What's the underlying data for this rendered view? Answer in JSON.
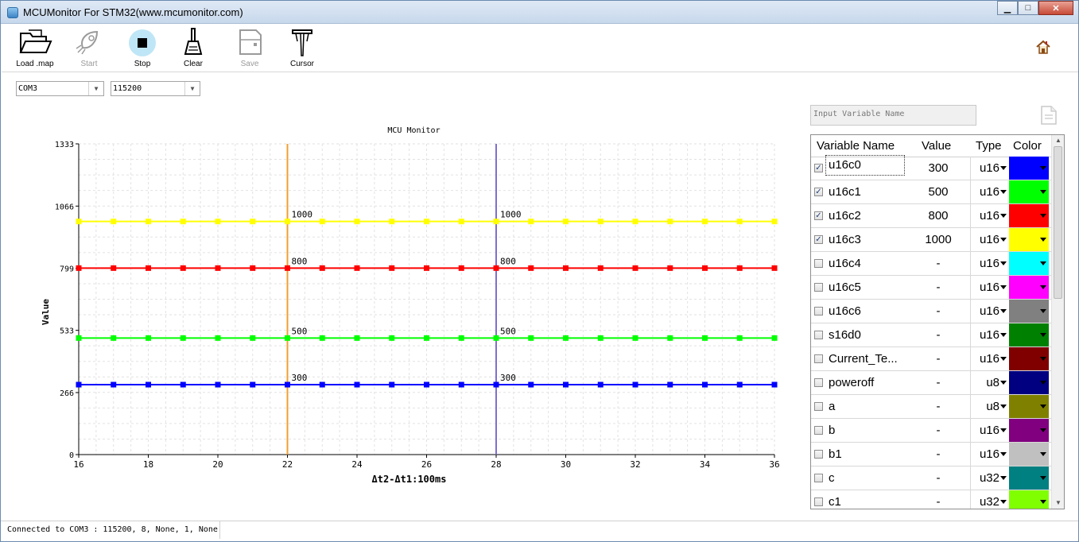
{
  "window": {
    "title": "MCUMonitor For STM32(www.mcumonitor.com)",
    "controls": {
      "minimize": "▁",
      "maximize": "□",
      "close": "✕"
    }
  },
  "toolbar": {
    "tools": [
      {
        "label": "Load .map",
        "icon": "folder-open-icon",
        "enabled": true
      },
      {
        "label": "Start",
        "icon": "rocket-icon",
        "enabled": false
      },
      {
        "label": "Stop",
        "icon": "stop-icon",
        "enabled": true
      },
      {
        "label": "Clear",
        "icon": "broom-icon",
        "enabled": true
      },
      {
        "label": "Save",
        "icon": "save-icon",
        "enabled": false
      },
      {
        "label": "Cursor",
        "icon": "caliper-icon",
        "enabled": true
      }
    ],
    "home_icon": "home-icon"
  },
  "serial": {
    "port": "COM3",
    "baud": "115200"
  },
  "search": {
    "placeholder": "Input Variable Name"
  },
  "chart_data": {
    "type": "line",
    "title": "MCU Monitor",
    "xlabel": "Δt2-Δt1:100ms",
    "ylabel": "Value",
    "xlim": [
      16,
      36
    ],
    "ylim": [
      0,
      1333
    ],
    "x_ticks": [
      16,
      18,
      20,
      22,
      24,
      26,
      28,
      30,
      32,
      34,
      36
    ],
    "y_ticks": [
      0,
      266,
      533,
      799,
      1066,
      1333
    ],
    "grid": true,
    "x": [
      16,
      17,
      18,
      19,
      20,
      21,
      22,
      23,
      24,
      25,
      26,
      27,
      28,
      29,
      30,
      31,
      32,
      33,
      34,
      35,
      36
    ],
    "series": [
      {
        "name": "u16c0",
        "color": "#0000ff",
        "value": 300
      },
      {
        "name": "u16c1",
        "color": "#00ff00",
        "value": 500
      },
      {
        "name": "u16c2",
        "color": "#ff0000",
        "value": 800
      },
      {
        "name": "u16c3",
        "color": "#ffff00",
        "value": 1000
      }
    ],
    "cursors": [
      {
        "x": 22,
        "color": "#f0a030",
        "labels": [
          "1000",
          "800",
          "500",
          "300"
        ]
      },
      {
        "x": 28,
        "color": "#7f6fd0",
        "labels": [
          "1000",
          "800",
          "500",
          "300"
        ]
      }
    ]
  },
  "table": {
    "headers": {
      "name": "Variable Name",
      "value": "Value",
      "type": "Type",
      "color": "Color"
    },
    "rows": [
      {
        "name": "u16c0",
        "value": "300",
        "type": "u16",
        "color": "#0000ff",
        "checked": true
      },
      {
        "name": "u16c1",
        "value": "500",
        "type": "u16",
        "color": "#00ff00",
        "checked": true
      },
      {
        "name": "u16c2",
        "value": "800",
        "type": "u16",
        "color": "#ff0000",
        "checked": true
      },
      {
        "name": "u16c3",
        "value": "1000",
        "type": "u16",
        "color": "#ffff00",
        "checked": true
      },
      {
        "name": "u16c4",
        "value": "-",
        "type": "u16",
        "color": "#00ffff",
        "checked": false
      },
      {
        "name": "u16c5",
        "value": "-",
        "type": "u16",
        "color": "#ff00ff",
        "checked": false
      },
      {
        "name": "u16c6",
        "value": "-",
        "type": "u16",
        "color": "#808080",
        "checked": false
      },
      {
        "name": "s16d0",
        "value": "-",
        "type": "u16",
        "color": "#008000",
        "checked": false
      },
      {
        "name": "Current_Te...",
        "value": "-",
        "type": "u16",
        "color": "#800000",
        "checked": false
      },
      {
        "name": "poweroff",
        "value": "-",
        "type": "u8",
        "color": "#000080",
        "checked": false
      },
      {
        "name": "a",
        "value": "-",
        "type": "u8",
        "color": "#808000",
        "checked": false
      },
      {
        "name": "b",
        "value": "-",
        "type": "u16",
        "color": "#800080",
        "checked": false
      },
      {
        "name": "b1",
        "value": "-",
        "type": "u16",
        "color": "#c0c0c0",
        "checked": false
      },
      {
        "name": "c",
        "value": "-",
        "type": "u32",
        "color": "#008080",
        "checked": false
      },
      {
        "name": "c1",
        "value": "-",
        "type": "u32",
        "color": "#80ff00",
        "checked": false
      }
    ]
  },
  "status": {
    "text": "Connected to COM3 : 115200, 8, None, 1, None"
  }
}
